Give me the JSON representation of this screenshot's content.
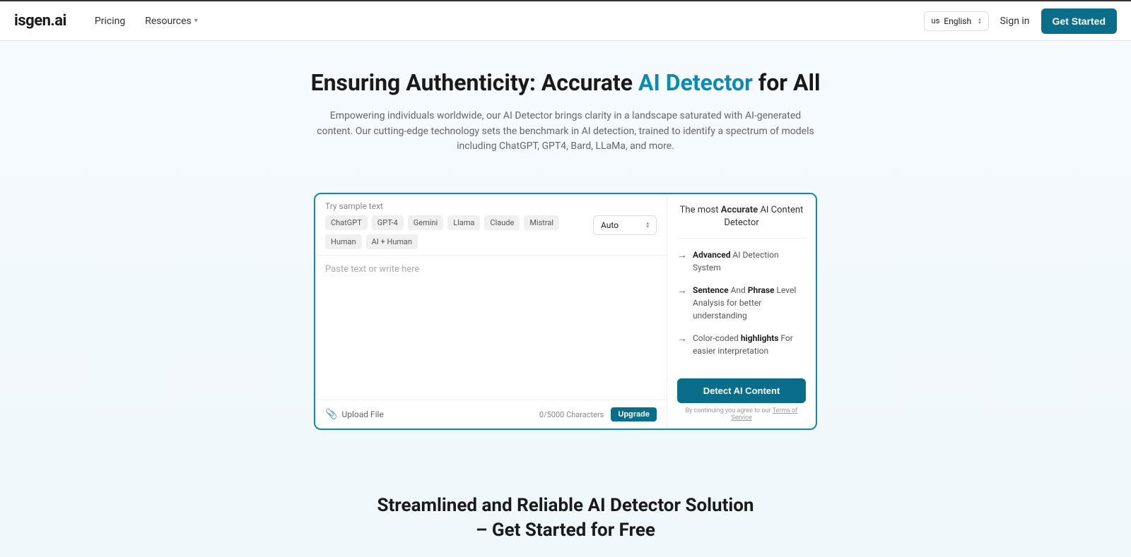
{
  "brand": "isgen.ai",
  "nav": {
    "pricing": "Pricing",
    "resources": "Resources"
  },
  "lang": {
    "flag": "us",
    "label": "English"
  },
  "signin": "Sign in",
  "get_started": "Get Started",
  "hero": {
    "title_pre": "Ensuring Authenticity: Accurate ",
    "title_highlight": "AI Detector",
    "title_post": " for All",
    "subtitle": "Empowering individuals worldwide, our AI Detector brings clarity in a landscape saturated with AI-generated content. Our cutting-edge technology sets the benchmark in AI detection, trained to identify a spectrum of models including ChatGPT, GPT4, Bard, LLaMa, and more."
  },
  "detector": {
    "sample_label": "Try sample text",
    "chips": [
      "ChatGPT",
      "GPT-4",
      "Gemini",
      "Llama",
      "Claude",
      "Mistral",
      "Human",
      "AI + Human"
    ],
    "mode": "Auto",
    "placeholder": "Paste text or write here",
    "upload": "Upload File",
    "counter": "0/5000 Characters",
    "upgrade": "Upgrade",
    "right_title_pre": "The most ",
    "right_title_bold": "Accurate",
    "right_title_post": " AI Content Detector",
    "features": {
      "f1_b1": "Advanced",
      "f1_rest": " AI Detection System",
      "f2_b1": "Sentence",
      "f2_mid1": " And ",
      "f2_b2": "Phrase",
      "f2_rest": " Level Analysis for better understanding",
      "f3_pre": "Color-coded ",
      "f3_b": "highlights",
      "f3_post": " For easier interpretation"
    },
    "detect_btn": "Detect AI Content",
    "terms_pre": "By continuing you agree to our ",
    "terms_link": "Terms of Service"
  },
  "section2": {
    "line1": "Streamlined and Reliable AI Detector Solution",
    "line2": "– Get Started for Free"
  }
}
